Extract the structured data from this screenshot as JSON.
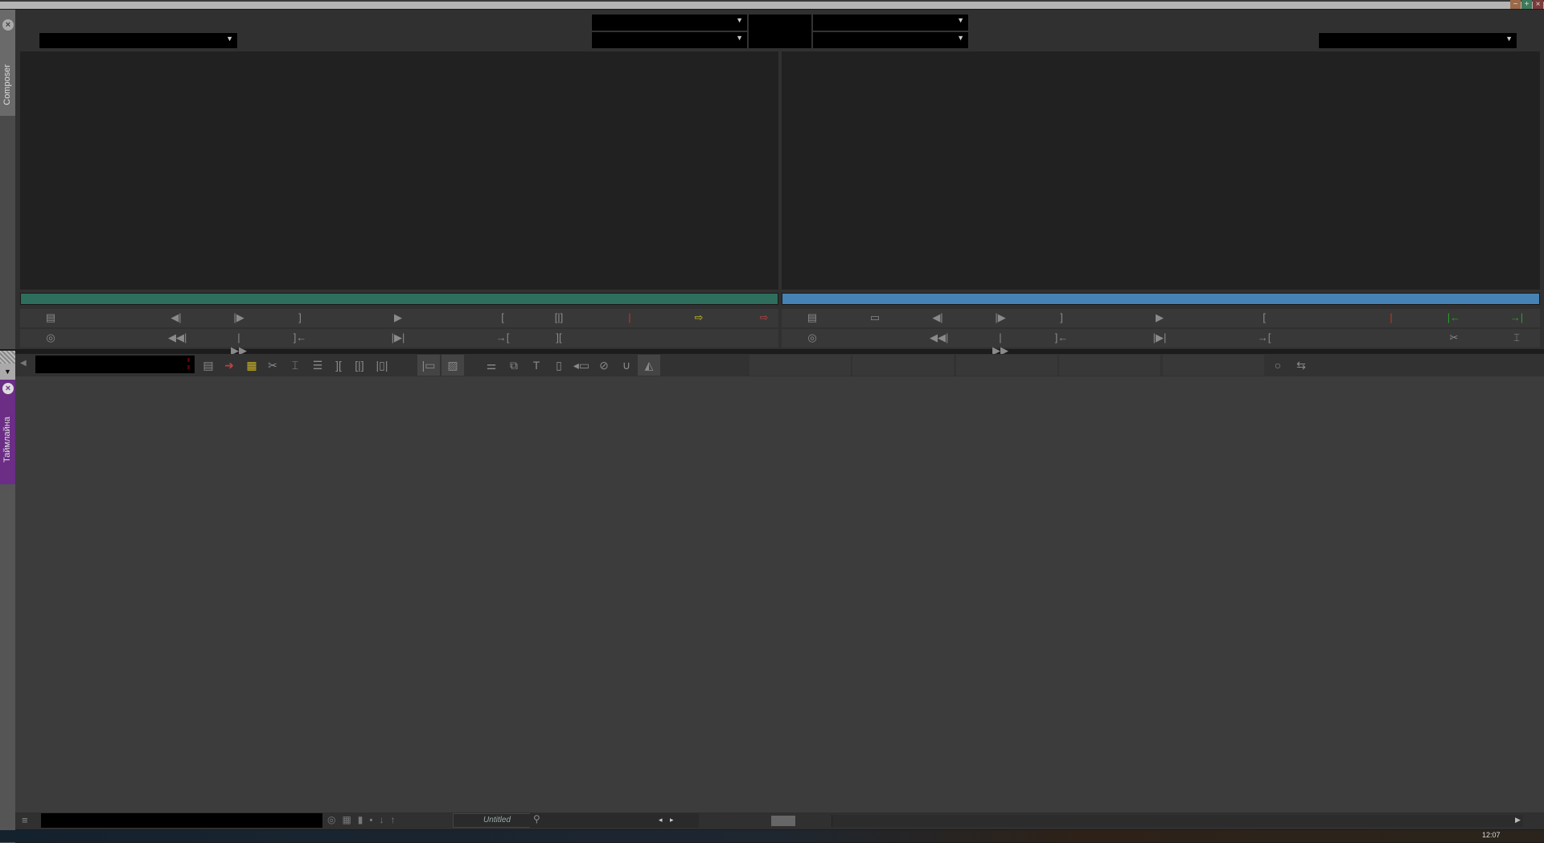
{
  "window": {
    "controls": {
      "minimize": "−",
      "maximize": "+",
      "close": "×"
    }
  },
  "composer": {
    "tab_label": "Composer",
    "close_icon": "×",
    "source_dropdown": {
      "value": "",
      "arrow": "▼"
    },
    "record_dropdown": {
      "value": "",
      "arrow": "▼"
    },
    "center_dropdowns": [
      {
        "value": "",
        "arrow": "▼"
      },
      {
        "value": "",
        "arrow": "▼"
      },
      {
        "value": "",
        "arrow": "▼"
      },
      {
        "value": "",
        "arrow": "▼"
      }
    ],
    "source_bar_color": "#2d6e5c",
    "record_bar_color": "#4682b4"
  },
  "source_buttons_row1": [
    "▤",
    "◀|",
    "|▶",
    "]",
    "▶",
    "[",
    "[|]",
    "|",
    "⇨",
    "⇨"
  ],
  "source_buttons_row2": [
    "◎",
    "◀◀|",
    "|▶▶",
    "]←",
    "|▶|",
    "→[",
    "]["
  ],
  "record_buttons_row1": [
    "▤",
    "▭",
    "◀|",
    "|▶",
    "]",
    "▶",
    "[",
    "|",
    "|←",
    "→|"
  ],
  "record_buttons_row2": [
    "◎",
    "◀◀|",
    "|▶▶",
    "]←",
    "|▶|",
    "→[",
    "✂",
    "⌶"
  ],
  "timeline": {
    "tab_label": "Таймлайна",
    "close_icon": "×",
    "collapse_icon": "▼",
    "timecode": "",
    "tools": [
      "▤",
      "➜",
      "▦",
      "✂",
      "⌶",
      "☰",
      "][",
      "[|]",
      "|▯|",
      "|▭",
      "▨",
      "⚌",
      "⧉",
      "T",
      "▯",
      "◂▭",
      "⊘",
      "∪",
      "◭"
    ],
    "status_icons": [
      "○",
      "⇆"
    ]
  },
  "bottom": {
    "menu_icon": "≡",
    "sequence_name": "Untitled",
    "search_icon": "⚲",
    "nav": [
      "◂",
      "▸"
    ]
  },
  "taskbar": {
    "clock": "12:07"
  }
}
